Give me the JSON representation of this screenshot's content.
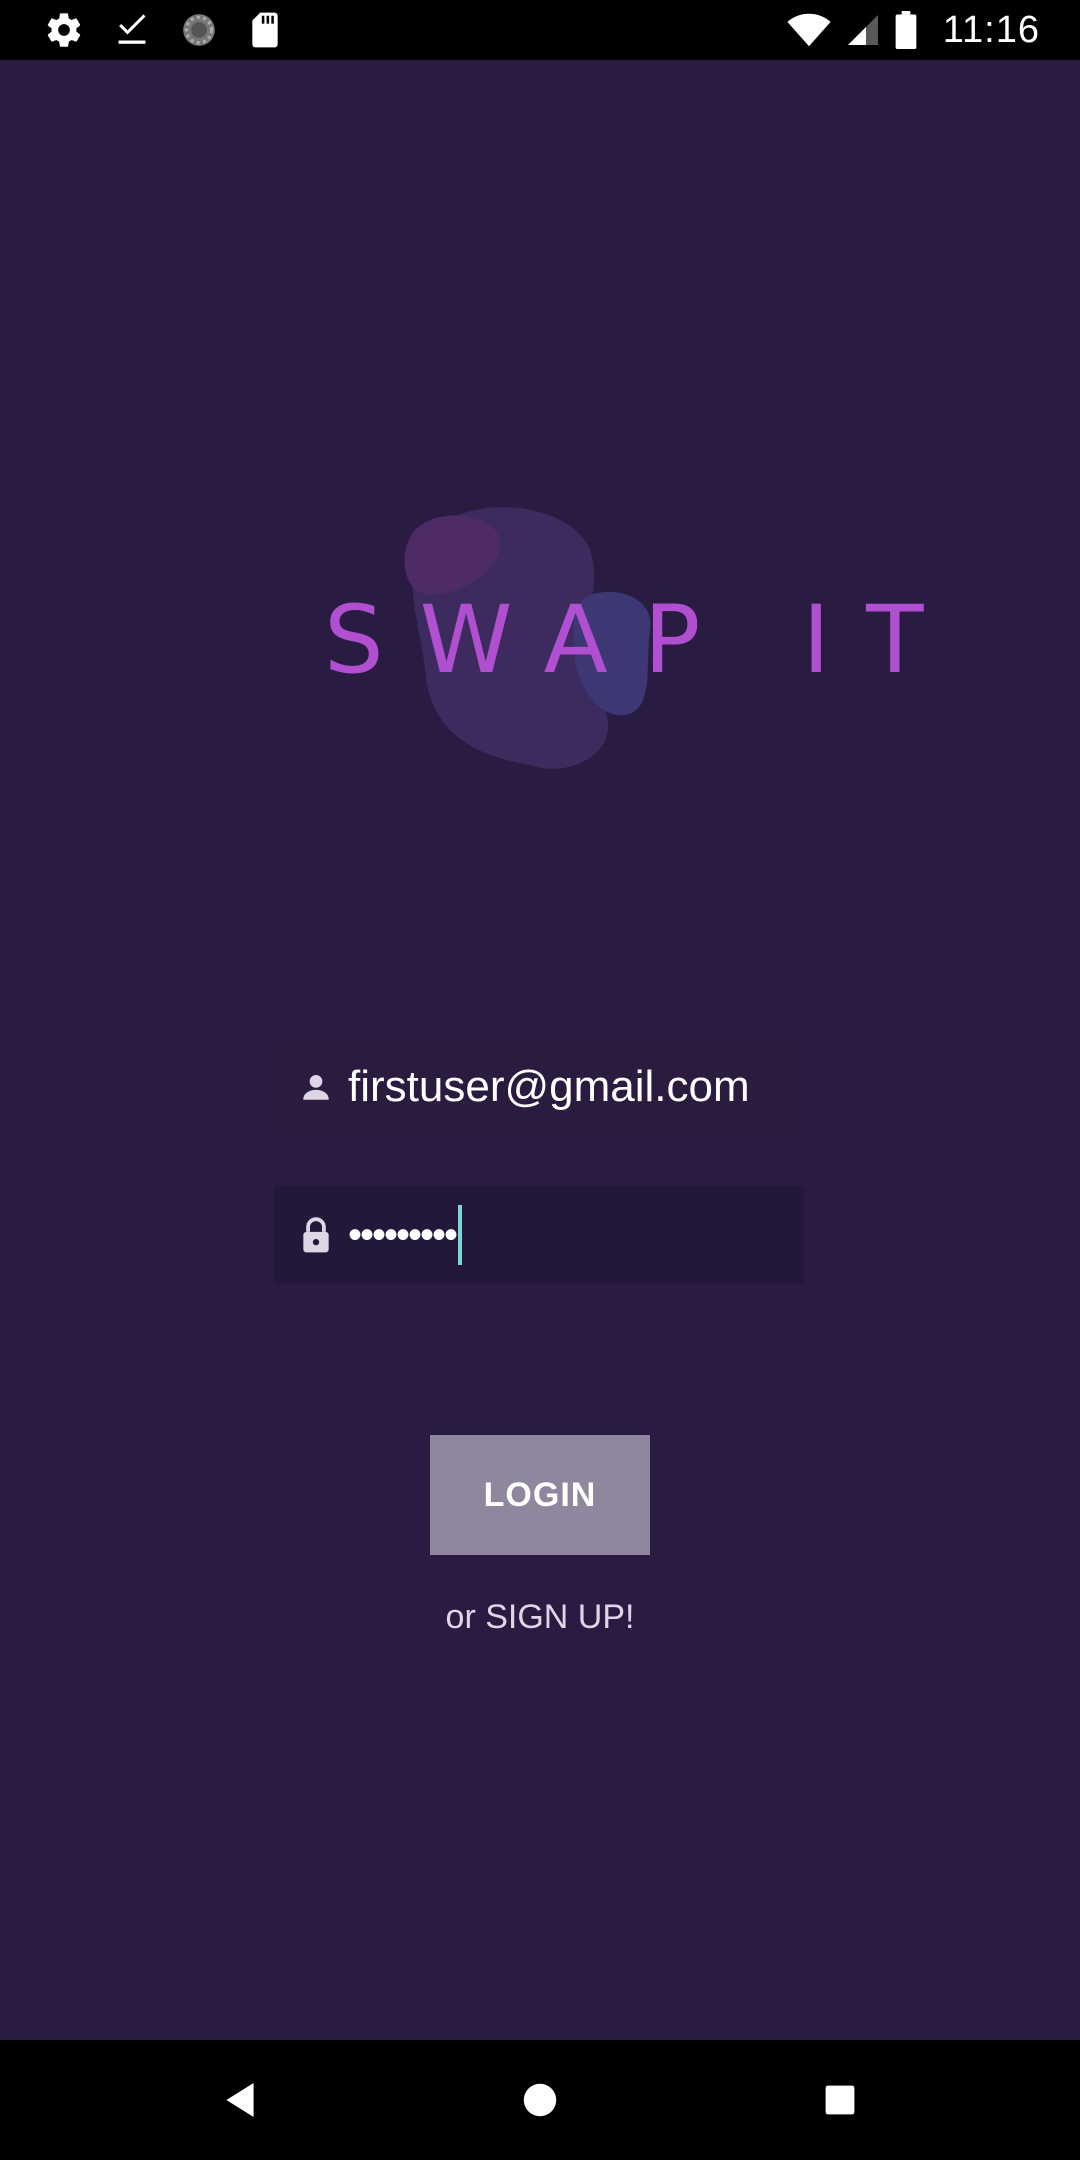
{
  "status_bar": {
    "time": "11:16",
    "left_icons": [
      "settings-icon",
      "download-done-icon",
      "sync-circle-icon",
      "sd-card-icon"
    ],
    "right_icons": [
      "wifi-icon",
      "cell-signal-icon",
      "battery-icon"
    ]
  },
  "logo": {
    "text": "SWAP IT",
    "color": "#b04fd0"
  },
  "login_form": {
    "email": {
      "icon": "person-icon",
      "value": "firstuser@gmail.com"
    },
    "password": {
      "icon": "lock-icon",
      "value": "•••••••••"
    },
    "login_label": "LOGIN",
    "signup_label": "or SIGN UP!"
  },
  "nav_bar": {
    "buttons": [
      "back-icon",
      "home-icon",
      "recents-icon"
    ]
  },
  "colors": {
    "background": "#2a1b42",
    "button": "#8f879d",
    "cursor": "#7fd5d1"
  }
}
